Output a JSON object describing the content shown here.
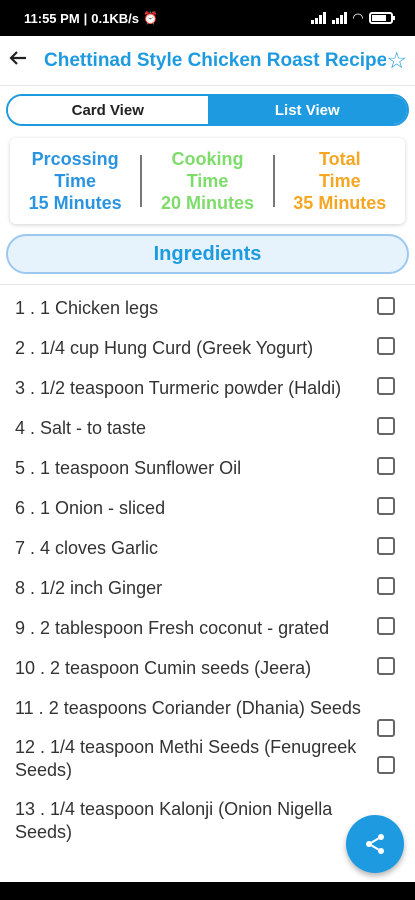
{
  "status": {
    "time": "11:55 PM",
    "speed": "0.1KB/s",
    "battery_level": 0.7
  },
  "header": {
    "title": "Chettinad Style Chicken Roast Recipe",
    "back_icon": "arrow-left-icon",
    "favorite_icon": "star-outline-icon"
  },
  "view_toggle": {
    "card_label": "Card View",
    "list_label": "List View",
    "selected": "List View"
  },
  "times": {
    "processing": {
      "l1": "Prcossing",
      "l2": "Time",
      "value": "15 Minutes"
    },
    "cooking": {
      "l1": "Cooking",
      "l2": "Time",
      "value": "20 Minutes"
    },
    "total": {
      "l1": "Total",
      "l2": "Time",
      "value": "35 Minutes"
    }
  },
  "ingredients_header": "Ingredients",
  "ingredients": [
    {
      "text": "1 . 1 Chicken legs"
    },
    {
      "text": "2 . 1/4 cup Hung Curd (Greek Yogurt)"
    },
    {
      "text": "3 . 1/2 teaspoon Turmeric powder (Haldi)"
    },
    {
      "text": "4 . Salt - to taste"
    },
    {
      "text": "5 . 1 teaspoon Sunflower Oil"
    },
    {
      "text": "6 . 1 Onion - sliced"
    },
    {
      "text": "7 . 4 cloves Garlic"
    },
    {
      "text": "8 . 1/2 inch Ginger"
    },
    {
      "text": "9 . 2 tablespoon Fresh coconut - grated"
    },
    {
      "text": "10 . 2 teaspoon Cumin seeds (Jeera)"
    },
    {
      "text": "11 . 2 teaspoons Coriander (Dhania) Seeds"
    },
    {
      "text": "12 . 1/4 teaspoon Methi Seeds (Fenugreek Seeds)"
    },
    {
      "text": "13 . 1/4 teaspoon Kalonji (Onion Nigella Seeds)"
    }
  ],
  "colors": {
    "accent": "#1e9be0",
    "processing": "#2b94e0",
    "cooking": "#7ddc6a",
    "total": "#f5a623"
  },
  "fab_icon": "share-icon"
}
